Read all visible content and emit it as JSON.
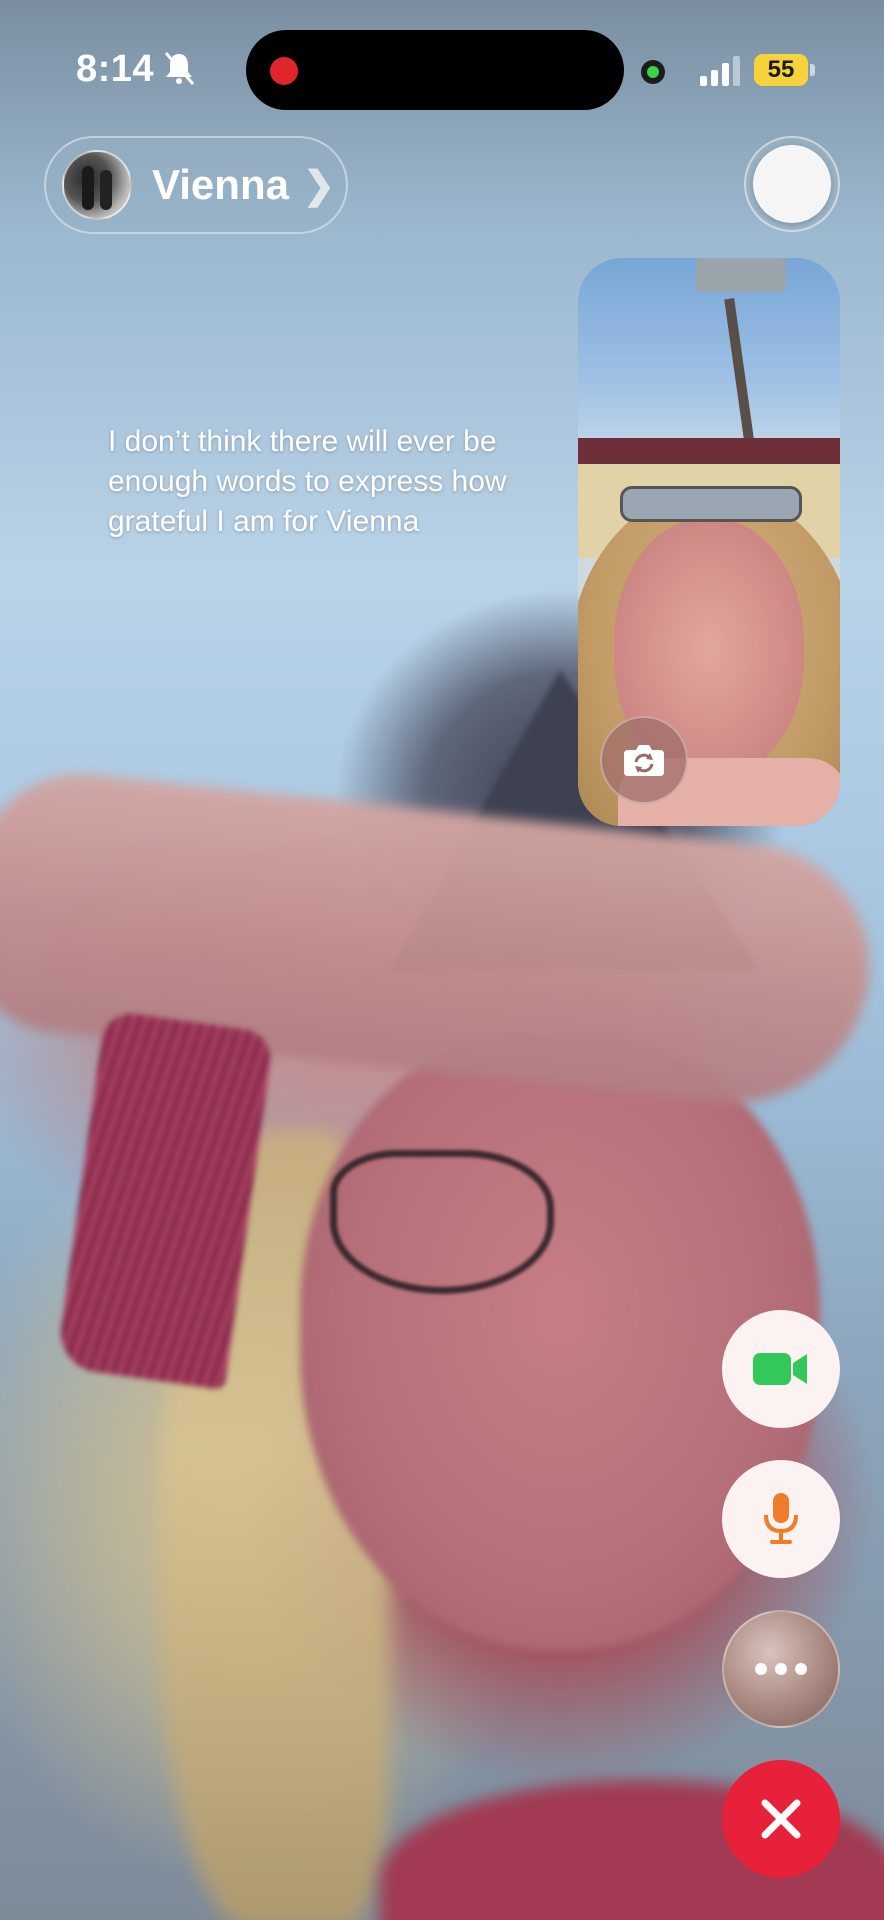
{
  "status_bar": {
    "time": "8:14",
    "battery_percent": "55",
    "silent_mode": true,
    "recording_indicator_color": "#e0262b",
    "camera_in_use_indicator_color": "#3bd34a"
  },
  "call_header": {
    "contact_name": "Vienna",
    "chevron": "❯"
  },
  "caption": {
    "text": "I don’t think there will ever be enough words to express how grateful I am for Vienna"
  },
  "controls": {
    "video_icon": "video-camera-icon",
    "video_color": "#34c759",
    "mic_icon": "microphone-icon",
    "mic_color": "#f07b2a",
    "more_icon": "ellipsis-icon",
    "end_call_icon": "close-icon",
    "end_call_color": "#e8213a"
  }
}
